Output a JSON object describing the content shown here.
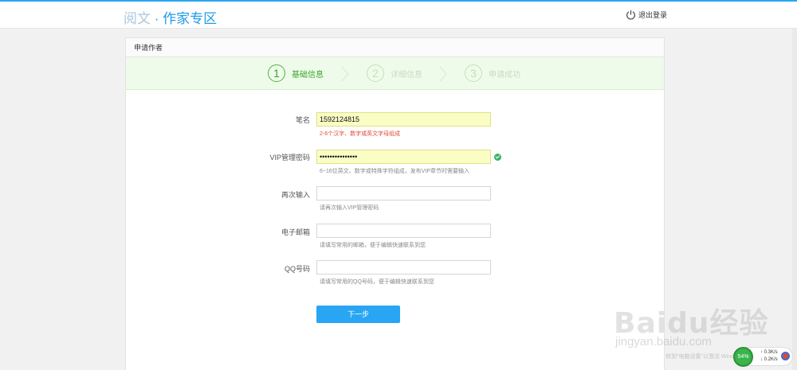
{
  "header": {
    "logo_part1": "阅文",
    "logo_sep": "·",
    "logo_part2": "作家专区",
    "logout_label": "退出登录"
  },
  "panel": {
    "title": "申请作者"
  },
  "steps": [
    {
      "num": "1",
      "label": "基础信息",
      "active": true
    },
    {
      "num": "2",
      "label": "详细信息",
      "active": false
    },
    {
      "num": "3",
      "label": "申请成功",
      "active": false
    }
  ],
  "form": {
    "pen_name": {
      "label": "笔名",
      "value": "1592124815",
      "hint": "2-6个汉字、数字或英文字母组成"
    },
    "vip_password": {
      "label": "VIP管理密码",
      "value": "•••••••••••••••",
      "hint": "6~16位英文、数字或特殊字符组成，发布VIP章节时需要输入"
    },
    "confirm_password": {
      "label": "再次输入",
      "value": "",
      "hint": "请再次输入VIP管理密码"
    },
    "email": {
      "label": "电子邮箱",
      "value": "",
      "hint": "请填写常用的邮箱，便于编辑快速联系到您"
    },
    "qq": {
      "label": "QQ号码",
      "value": "",
      "hint": "请填写常用的QQ号码，便于编辑快速联系到您"
    },
    "next_label": "下一步"
  },
  "watermark": {
    "brand": "Baidu经验",
    "site": "jingyan.baidu.com",
    "note": "转到\"电脑设置\"以激活 Windows"
  },
  "net_widget": {
    "percent": "54%",
    "up": "0.3K/s",
    "down": "0.2K/s"
  },
  "colors": {
    "accent": "#29a6f3",
    "step_active": "#3aa52a",
    "error_hint": "#e14b3b",
    "filled_bg": "#fafdc4"
  }
}
